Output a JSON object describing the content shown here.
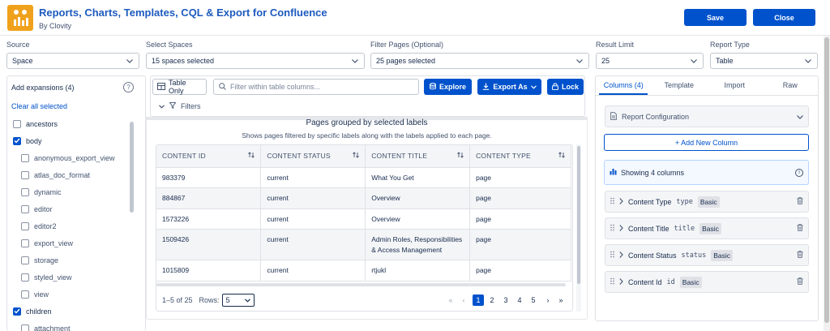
{
  "header": {
    "title": "Reports, Charts, Templates, CQL & Export for Confluence",
    "byline": "By Clovity",
    "save_label": "Save",
    "close_label": "Close",
    "accent": "#0052cc",
    "logo_color": "#f0a11c"
  },
  "selectors": {
    "source": {
      "label": "Source",
      "value": "Space"
    },
    "spaces": {
      "label": "Select Spaces",
      "value": "15 spaces selected"
    },
    "filter_pages": {
      "label": "Filter Pages (Optional)",
      "value": "25 pages selected"
    },
    "result_limit": {
      "label": "Result Limit",
      "value": "25"
    },
    "report_type": {
      "label": "Report Type",
      "value": "Table"
    }
  },
  "expansions": {
    "heading": "Add expansions (4)",
    "clear_label": "Clear all selected",
    "items": [
      {
        "label": "ancestors",
        "checked": false,
        "level": 0
      },
      {
        "label": "body",
        "checked": true,
        "level": 0
      },
      {
        "label": "anonymous_export_view",
        "checked": false,
        "level": 1
      },
      {
        "label": "atlas_doc_format",
        "checked": false,
        "level": 1
      },
      {
        "label": "dynamic",
        "checked": false,
        "level": 1
      },
      {
        "label": "editor",
        "checked": false,
        "level": 1
      },
      {
        "label": "editor2",
        "checked": false,
        "level": 1
      },
      {
        "label": "export_view",
        "checked": false,
        "level": 1
      },
      {
        "label": "storage",
        "checked": false,
        "level": 1
      },
      {
        "label": "styled_view",
        "checked": false,
        "level": 1
      },
      {
        "label": "view",
        "checked": false,
        "level": 1
      },
      {
        "label": "children",
        "checked": true,
        "level": 0
      },
      {
        "label": "attachment",
        "checked": false,
        "level": 1
      }
    ]
  },
  "toolbar": {
    "table_only_label": "Table Only",
    "filter_placeholder": "Filter within table columns...",
    "explore_label": "Explore",
    "export_label": "Export As",
    "lock_label": "Lock",
    "filters_label": "Filters"
  },
  "report": {
    "title": "Pages grouped by selected labels",
    "subtitle": "Shows pages filtered by specific labels along with the labels applied to each page.",
    "columns": [
      "CONTENT ID",
      "CONTENT STATUS",
      "CONTENT TITLE",
      "CONTENT TYPE"
    ],
    "rows": [
      [
        "983379",
        "current",
        "What You Get",
        "page"
      ],
      [
        "884867",
        "current",
        "Overview",
        "page"
      ],
      [
        "1573226",
        "current",
        "Overview",
        "page"
      ],
      [
        "1509426",
        "current",
        "Admin Roles, Responsibilities & Access Management",
        "page"
      ],
      [
        "1015809",
        "current",
        "rtjukl",
        "page"
      ]
    ]
  },
  "pager": {
    "range_text": "1–5 of 25",
    "rows_label": "Rows:",
    "rows_value": "5",
    "pages": [
      "1",
      "2",
      "3",
      "4",
      "5"
    ],
    "active_page": "1"
  },
  "right_panel": {
    "tabs": [
      "Columns (4)",
      "Template",
      "Import",
      "Raw"
    ],
    "active_tab": "Columns (4)",
    "config_label": "Report Configuration",
    "add_column_label": "+ Add New Column",
    "showing_label": "Showing 4 columns",
    "columns": [
      {
        "name": "Content Type",
        "key": "type",
        "badge": "Basic"
      },
      {
        "name": "Content Title",
        "key": "title",
        "badge": "Basic"
      },
      {
        "name": "Content Status",
        "key": "status",
        "badge": "Basic"
      },
      {
        "name": "Content Id",
        "key": "id",
        "badge": "Basic"
      }
    ]
  }
}
